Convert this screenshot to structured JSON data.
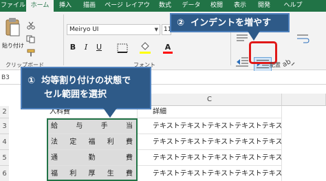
{
  "ribbon": {
    "tabs": [
      "ファイル",
      "ホーム",
      "挿入",
      "描画",
      "ページ レイアウト",
      "数式",
      "データ",
      "校閲",
      "表示",
      "開発",
      "ヘルプ"
    ],
    "active_tab": "ホーム",
    "paste_label": "貼り付け",
    "clipboard_label": "クリップボード",
    "font_label": "フォント",
    "align_label": "配置",
    "font_name": "Meiryo UI",
    "font_size": "11",
    "bold": "B",
    "italic": "I",
    "underline": "U",
    "font_color_icon": "A",
    "accent_color": "#217346",
    "fill_color": "#ffff00",
    "font_color": "#ff0000"
  },
  "formula_bar": {
    "name_box": "B3"
  },
  "sheet": {
    "col_c": "C",
    "row_numbers": [
      "2",
      "3",
      "4",
      "5",
      "6"
    ],
    "header_b": "入科費",
    "header_c": "詳細",
    "rows": [
      {
        "b_chars": [
          "給",
          "与",
          "手",
          "当"
        ],
        "c": "テキストテキストテキストテキストテキスト"
      },
      {
        "b_chars": [
          "法",
          "定",
          "福",
          "利",
          "費"
        ],
        "c": "テキストテキストテキストテキストテキスト"
      },
      {
        "b_chars": [
          "通",
          "勤",
          "費"
        ],
        "c": "テキストテキストテキストテキストテキスト"
      },
      {
        "b_chars": [
          "福",
          "利",
          "厚",
          "生",
          "費"
        ],
        "c": "テキストテキストテキストテキストテキスト"
      }
    ]
  },
  "callouts": {
    "step1_num": "①",
    "step1_line1": "均等割り付けの状態で",
    "step1_line2": "セル範囲を選択",
    "step2_num": "②",
    "step2_text": "インデントを増やす"
  }
}
